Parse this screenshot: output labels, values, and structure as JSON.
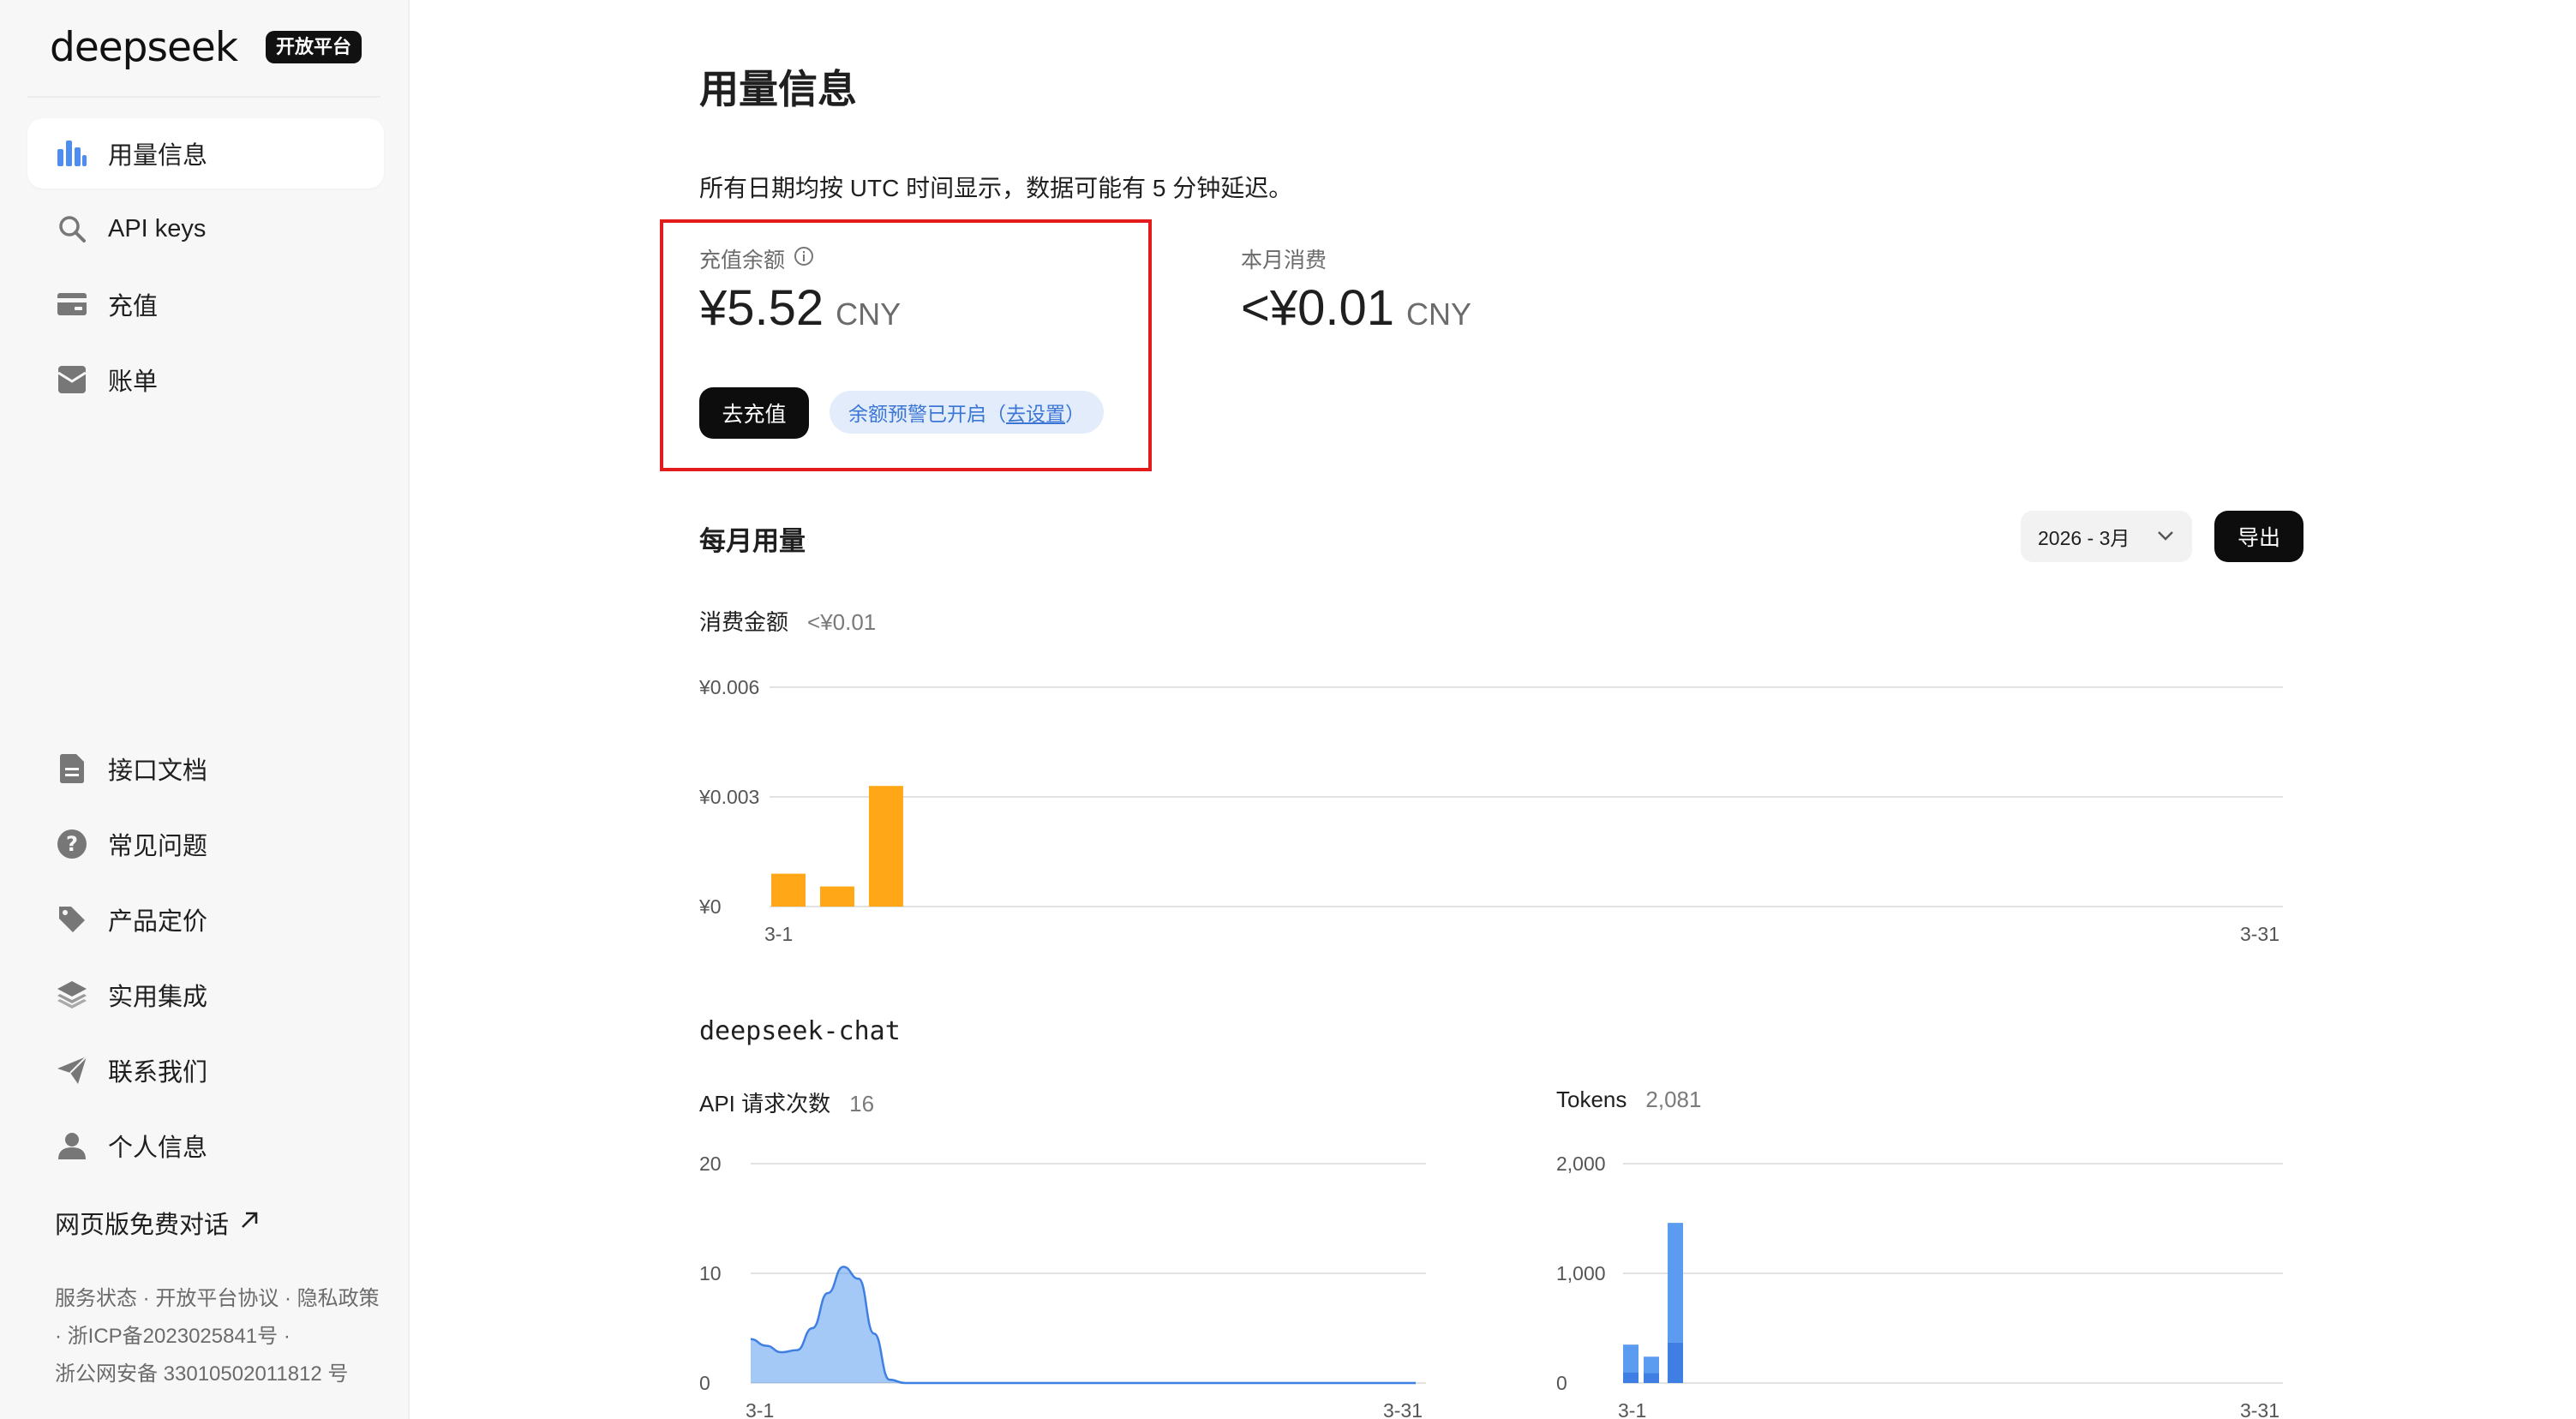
{
  "sidebar": {
    "logo": "deepseek",
    "badge": "开放平台",
    "nav_top": [
      {
        "label": "用量信息",
        "icon": "bar-chart-icon"
      },
      {
        "label": "API keys",
        "icon": "search-icon"
      },
      {
        "label": "充值",
        "icon": "wallet-icon"
      },
      {
        "label": "账单",
        "icon": "bill-icon"
      }
    ],
    "nav_bottom": [
      {
        "label": "接口文档",
        "icon": "document-icon"
      },
      {
        "label": "常见问题",
        "icon": "question-icon"
      },
      {
        "label": "产品定价",
        "icon": "tag-icon"
      },
      {
        "label": "实用集成",
        "icon": "layers-icon"
      },
      {
        "label": "联系我们",
        "icon": "send-icon"
      },
      {
        "label": "个人信息",
        "icon": "user-icon"
      }
    ],
    "webchat_label": "网页版免费对话",
    "footer": {
      "service_status": "服务状态",
      "platform_agreement": "开放平台协议",
      "privacy_policy": "隐私政策",
      "separator": " · ",
      "icp": "浙ICP备2023025841号",
      "police": "浙公网安备 33010502011812 号"
    }
  },
  "main": {
    "title": "用量信息",
    "notice": "所有日期均按 UTC 时间显示，数据可能有 5 分钟延迟。",
    "balance": {
      "label": "充值余额",
      "value": "¥5.52",
      "unit": "CNY",
      "recharge_button": "去充值",
      "alert_text": "余额预警已开启（",
      "alert_link": "去设置",
      "alert_close": "）"
    },
    "month_spend": {
      "label": "本月消费",
      "value": "<¥0.01",
      "unit": "CNY"
    },
    "monthly_usage": {
      "title": "每月用量",
      "month_selected": "2026 - 3月",
      "export_button": "导出"
    },
    "cost_metric": {
      "label": "消费金额",
      "value": "<¥0.01"
    },
    "model_name": "deepseek-chat",
    "requests_metric": {
      "label": "API 请求次数",
      "value": "16"
    },
    "tokens_metric": {
      "label": "Tokens",
      "value": "2,081"
    }
  },
  "colors": {
    "accent_orange": "#ffa716",
    "accent_blue": "#5b9cf0",
    "accent_blue_dark": "#3f7fe3",
    "highlight_red": "#e31b1b"
  },
  "chart_data": [
    {
      "type": "bar",
      "title": "",
      "x": [
        "3-1",
        "3-2",
        "3-3"
      ],
      "x_start_label": "3-1",
      "x_end_label": "3-31",
      "values": [
        0.0009,
        0.00055,
        0.0033
      ],
      "yticks": [
        {
          "v": 0,
          "label": "¥0"
        },
        {
          "v": 0.003,
          "label": "¥0.003"
        },
        {
          "v": 0.006,
          "label": "¥0.006"
        }
      ],
      "ylim": [
        0,
        0.006
      ],
      "grid": true
    },
    {
      "type": "area",
      "title": "",
      "x_start_label": "3-1",
      "x_end_label": "3-31",
      "values": [
        4,
        3.4,
        2.8,
        3,
        5,
        8.2,
        10.6,
        9.5,
        4.5,
        0.3,
        0,
        0,
        0,
        0,
        0,
        0,
        0,
        0,
        0,
        0,
        0,
        0,
        0,
        0,
        0,
        0,
        0,
        0,
        0,
        0,
        0
      ],
      "yticks": [
        {
          "v": 0,
          "label": "0"
        },
        {
          "v": 10,
          "label": "10"
        },
        {
          "v": 20,
          "label": "20"
        }
      ],
      "ylim": [
        0,
        20
      ],
      "grid": true
    },
    {
      "type": "bar",
      "title": "",
      "x_start_label": "3-1",
      "x_end_label": "3-31",
      "stacked": true,
      "categories": [
        "3-1",
        "3-2",
        "3-3"
      ],
      "series": [
        {
          "values": [
            100,
            90,
            370
          ]
        },
        {
          "values": [
            250,
            150,
            1090
          ]
        }
      ],
      "yticks": [
        {
          "v": 0,
          "label": "0"
        },
        {
          "v": 1000,
          "label": "1,000"
        },
        {
          "v": 2000,
          "label": "2,000"
        }
      ],
      "ylim": [
        0,
        2000
      ],
      "grid": true
    }
  ]
}
